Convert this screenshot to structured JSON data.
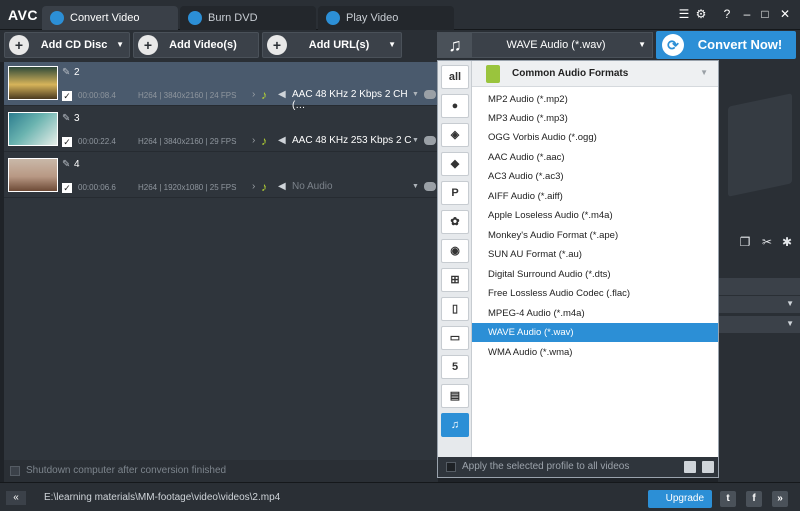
{
  "app": {
    "logo": "AVC"
  },
  "tabs": [
    {
      "label": "Convert Video",
      "icon": "refresh-icon"
    },
    {
      "label": "Burn DVD",
      "icon": "disc-icon"
    },
    {
      "label": "Play Video",
      "icon": "play-icon"
    }
  ],
  "toolbar": {
    "add_cd": "Add CD Disc",
    "add_video": "Add Video(s)",
    "add_url": "Add URL(s)",
    "profile": "WAVE Audio (*.wav)",
    "convert": "Convert Now!"
  },
  "files": [
    {
      "num": "2",
      "duration": "00:00:08.4",
      "codec": "H264 | 3840x2160 | 24 FPS",
      "audio": "AAC 48 KHz 2 Kbps 2 CH (…",
      "has_audio": true
    },
    {
      "num": "3",
      "duration": "00:00:22.4",
      "codec": "H264 | 3840x2160 | 29 FPS",
      "audio": "AAC 48 KHz 253 Kbps 2 C",
      "has_audio": true
    },
    {
      "num": "4",
      "duration": "00:00:06.6",
      "codec": "H264 | 1920x1080 | 25 FPS",
      "audio": "No Audio",
      "has_audio": false
    }
  ],
  "shutdown_label": "Shutdown computer after conversion finished",
  "dropdown": {
    "header": "Common Audio Formats",
    "categories": [
      "all",
      "apple",
      "android-robot",
      "android",
      "playstation",
      "huawei",
      "lg",
      "windows",
      "phone",
      "tv",
      "html5",
      "film",
      "music"
    ],
    "formats": [
      "MP2 Audio (*.mp2)",
      "MP3 Audio (*.mp3)",
      "OGG Vorbis Audio (*.ogg)",
      "AAC Audio (*.aac)",
      "AC3 Audio (*.ac3)",
      "AIFF Audio (*.aiff)",
      "Apple Loseless Audio (*.m4a)",
      "Monkey's Audio Format (*.ape)",
      "SUN AU Format (*.au)",
      "Digital Surround Audio (*.dts)",
      "Free Lossless Audio Codec (.flac)",
      "MPEG-4 Audio (*.m4a)",
      "WAVE Audio (*.wav)",
      "WMA Audio (*.wma)"
    ],
    "selected_index": 12,
    "apply_label": "Apply the selected profile to all videos"
  },
  "status": {
    "path": "E:\\learning materials\\MM-footage\\video\\videos\\2.mp4",
    "upgrade": "Upgrade"
  },
  "colors": {
    "accent": "#2c8fd6",
    "selection": "#4a5a6d",
    "audio_note": "#b4d334"
  }
}
